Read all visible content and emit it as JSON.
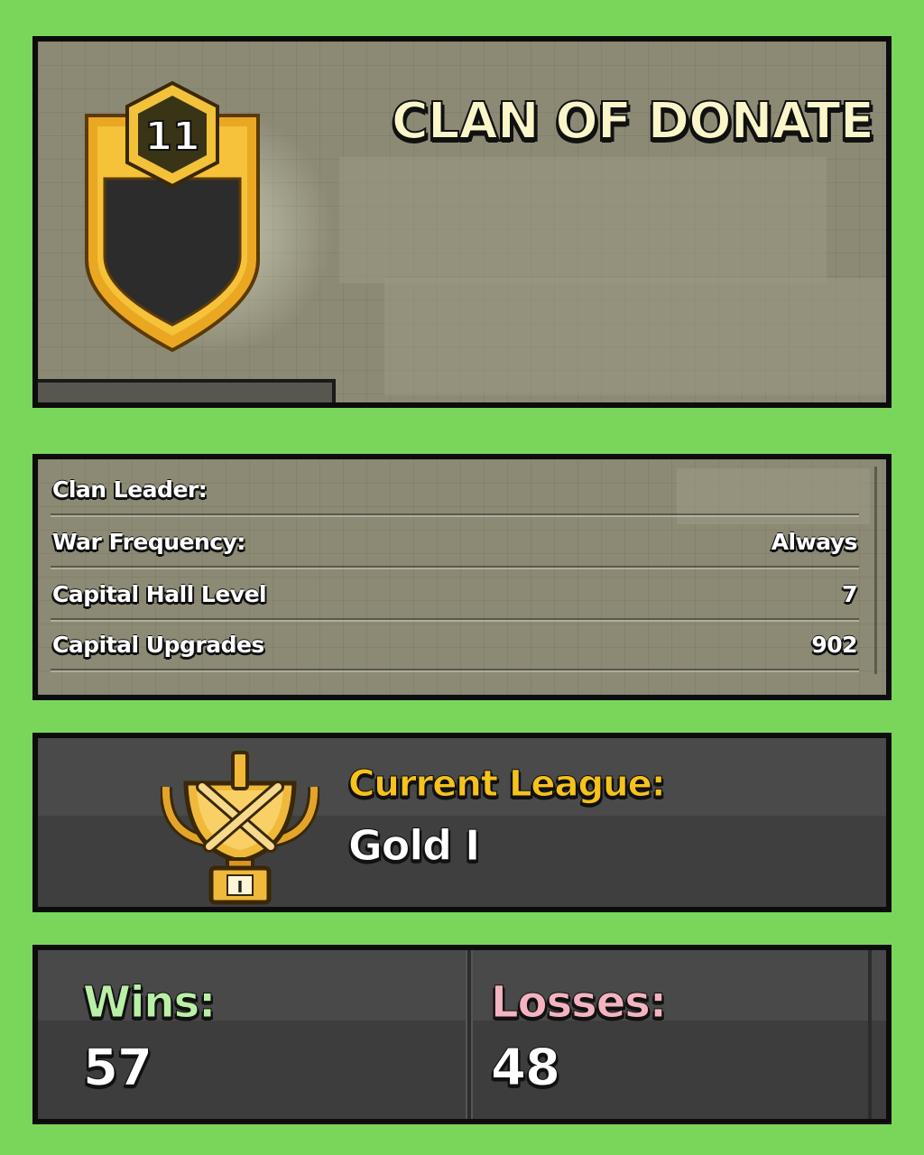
{
  "clan": {
    "badge_level": "11",
    "name": "CLAN OF DONATE"
  },
  "info": {
    "rows": [
      {
        "label": "Clan Leader:",
        "value": ""
      },
      {
        "label": "War Frequency:",
        "value": "Always"
      },
      {
        "label": "Capital Hall Level",
        "value": "7"
      },
      {
        "label": "Capital Upgrades",
        "value": "902"
      }
    ]
  },
  "league": {
    "title": "Current League:",
    "name": "Gold I",
    "icon_rank": "I"
  },
  "record": {
    "wins_label": "Wins:",
    "wins_value": "57",
    "losses_label": "Losses:",
    "losses_value": "48"
  },
  "colors": {
    "background": "#79d65a",
    "clan_name": "#fbf6c9",
    "league_title": "#f6c21c",
    "wins_label": "#b9f0a6",
    "losses_label": "#f4b3c1"
  }
}
